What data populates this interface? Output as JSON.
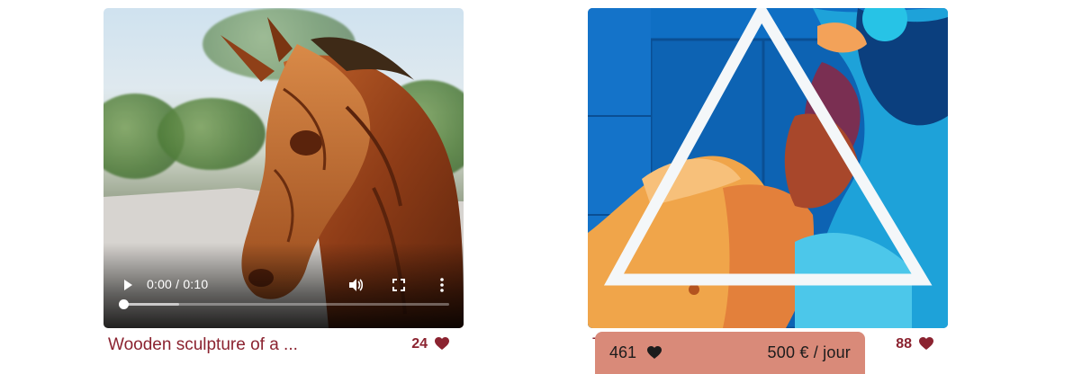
{
  "cards": [
    {
      "title": "Wooden sculpture of a ...",
      "likes": "24",
      "video": {
        "time": "0:00 / 0:10",
        "progress_buffered_percent": 17
      }
    },
    {
      "title": "T",
      "likes": "88",
      "hover": {
        "likes": "461",
        "price": "500 € / jour"
      }
    }
  ],
  "icons": {
    "heart": "heart-icon",
    "play": "play-icon",
    "volume": "volume-icon",
    "fullscreen": "fullscreen-icon",
    "more": "more-options-icon"
  },
  "colors": {
    "accent": "#8b2330",
    "hover_panel": "#d98a79"
  }
}
